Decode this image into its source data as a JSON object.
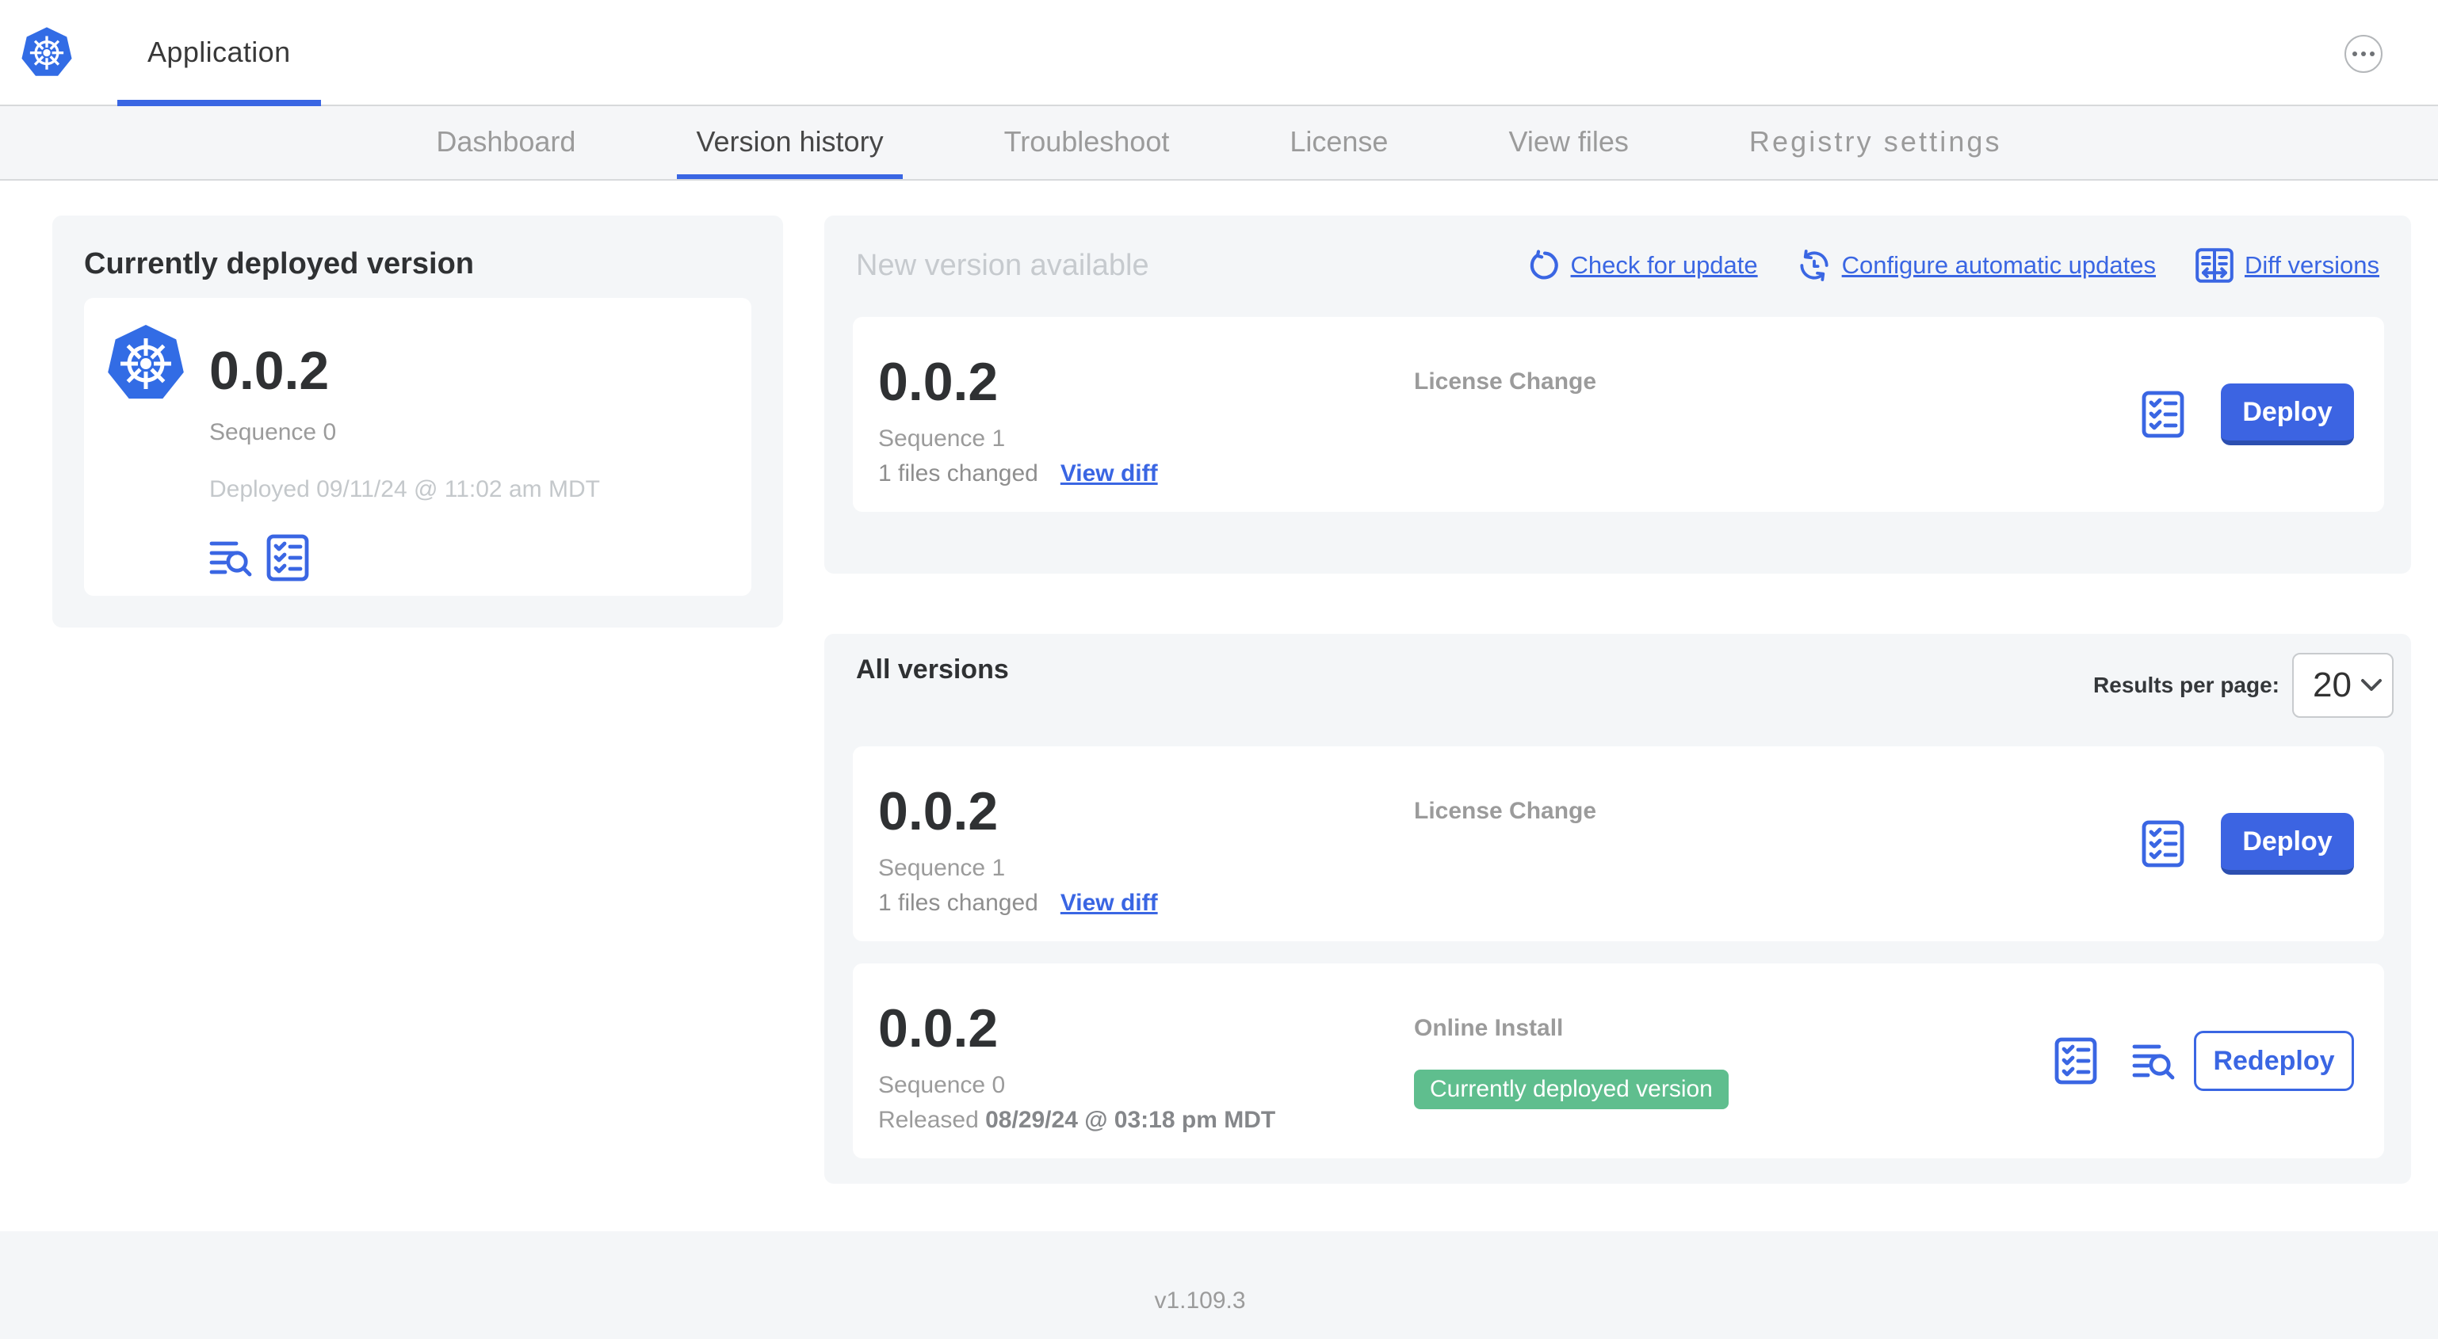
{
  "header": {
    "app_title": "Application",
    "ellipsis_icon": "ellipsis-menu"
  },
  "nav": {
    "tabs": [
      {
        "label": "Dashboard",
        "active": false
      },
      {
        "label": "Version history",
        "active": true
      },
      {
        "label": "Troubleshoot",
        "active": false
      },
      {
        "label": "License",
        "active": false
      },
      {
        "label": "View files",
        "active": false
      },
      {
        "label": "Registry settings",
        "active": false
      }
    ]
  },
  "deployed_card": {
    "title": "Currently deployed version",
    "app_icon": "kubernetes-logo",
    "version": "0.0.2",
    "sequence": "Sequence 0",
    "deployed_at": "Deployed 09/11/24 @ 11:02 am MDT",
    "icons": [
      "view-logs-icon",
      "preflight-checklist-icon"
    ]
  },
  "new_version_card": {
    "title": "New version available",
    "actions": [
      {
        "label": "Check for update",
        "icon": "refresh-icon"
      },
      {
        "label": "Configure automatic updates",
        "icon": "auto-update-icon"
      },
      {
        "label": "Diff versions",
        "icon": "diff-icon"
      }
    ],
    "row": {
      "version": "0.0.2",
      "sequence": "Sequence 1",
      "files_changed": "1 files changed",
      "view_diff_label": "View diff",
      "release_notes": "License Change",
      "deploy_label": "Deploy"
    }
  },
  "all_versions_card": {
    "title": "All versions",
    "results_per_page_label": "Results per page:",
    "results_per_page_value": "20",
    "rows": [
      {
        "version": "0.0.2",
        "sequence": "Sequence 1",
        "files_changed": "1 files changed",
        "view_diff_label": "View diff",
        "release_notes": "License Change",
        "deploy_label": "Deploy"
      },
      {
        "version": "0.0.2",
        "sequence": "Sequence 0",
        "released_prefix": "Released",
        "released_date": "08/29/24 @ 03:18 pm MDT",
        "release_notes": "Online Install",
        "status_badge": "Currently deployed version",
        "redeploy_label": "Redeploy"
      }
    ]
  },
  "footer": {
    "app_version": "v1.109.3"
  },
  "colors": {
    "primary_blue": "#3a66e3",
    "kubernetes_blue": "#326ce5",
    "badge_green": "#5fbe8e",
    "card_bg": "#f4f6f8",
    "text_dark": "#2f3133",
    "text_gray": "#9b9b9b",
    "text_light_gray": "#c3c7ca"
  }
}
